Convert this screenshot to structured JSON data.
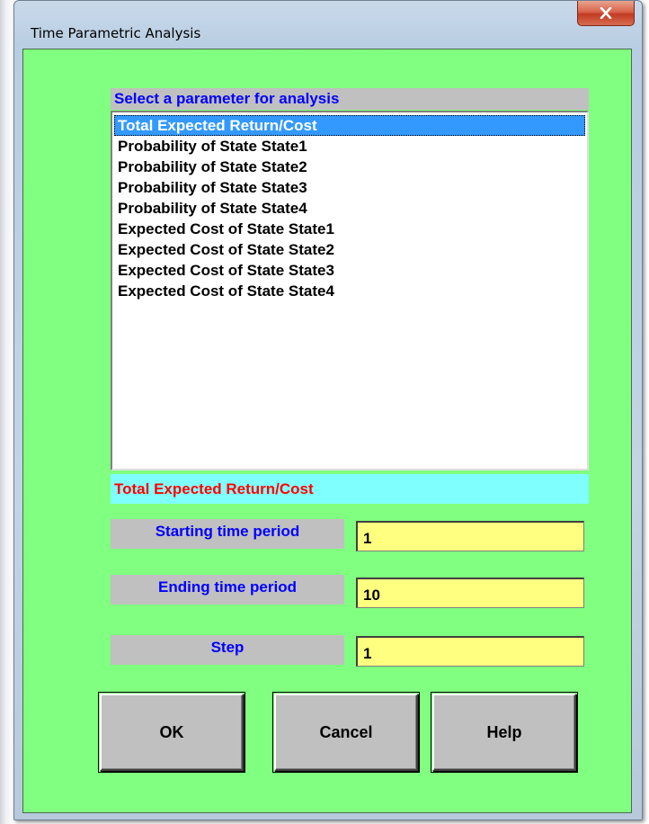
{
  "window": {
    "title": "Time Parametric Analysis",
    "close_icon": "close-x-icon"
  },
  "parameter_list": {
    "header": "Select a parameter for analysis",
    "items": [
      {
        "label": "Total Expected Return/Cost",
        "selected": true
      },
      {
        "label": "Probability of State State1",
        "selected": false
      },
      {
        "label": "Probability of State State2",
        "selected": false
      },
      {
        "label": "Probability of State State3",
        "selected": false
      },
      {
        "label": "Probability of State State4",
        "selected": false
      },
      {
        "label": "Expected Cost of State State1",
        "selected": false
      },
      {
        "label": "Expected Cost of State State2",
        "selected": false
      },
      {
        "label": "Expected Cost of State State3",
        "selected": false
      },
      {
        "label": "Expected Cost of State State4",
        "selected": false
      }
    ],
    "selected_display": "Total Expected Return/Cost"
  },
  "fields": {
    "start": {
      "label": "Starting time period",
      "value": "1"
    },
    "end": {
      "label": "Ending time period",
      "value": "10"
    },
    "step": {
      "label": "Step",
      "value": "1"
    }
  },
  "buttons": {
    "ok": "OK",
    "cancel": "Cancel",
    "help": "Help"
  },
  "colors": {
    "client_background": "#80ff80",
    "label_background": "#c0c0c0",
    "label_text": "#0000ff",
    "selected_display_background": "#80ffff",
    "selected_display_text": "#ff0000",
    "input_background": "#ffff80",
    "selection_highlight": "#3399ff"
  }
}
